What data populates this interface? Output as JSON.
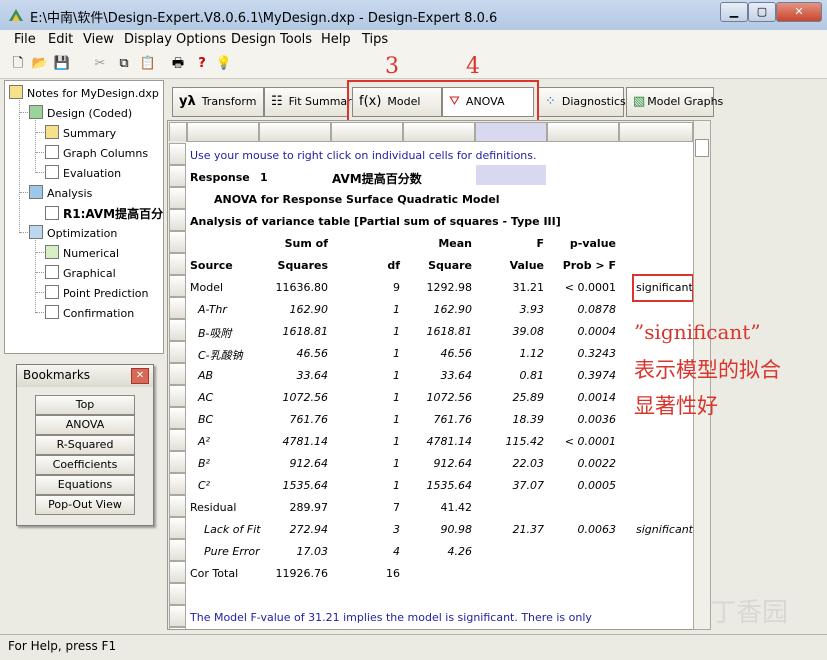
{
  "window": {
    "title": "E:\\中南\\软件\\Design-Expert.V8.0.6.1\\MyDesign.dxp - Design-Expert 8.0.6"
  },
  "menubar": [
    "File",
    "Edit",
    "View",
    "Display Options",
    "Design Tools",
    "Help",
    "Tips"
  ],
  "tree": {
    "root": "Notes for MyDesign.dxp",
    "design": "Design (Coded)",
    "summary": "Summary",
    "graph_columns": "Graph Columns",
    "evaluation": "Evaluation",
    "analysis": "Analysis",
    "response": "R1:AVM提高百分数",
    "optimization": "Optimization",
    "numerical": "Numerical",
    "graphical": "Graphical",
    "point_prediction": "Point Prediction",
    "confirmation": "Confirmation"
  },
  "bookmarks": {
    "title": "Bookmarks",
    "items": [
      "Top",
      "ANOVA",
      "R-Squared",
      "Coefficients",
      "Equations",
      "Pop-Out View"
    ]
  },
  "view_buttons": {
    "transform": "Transform",
    "fit_summary": "Fit Summary",
    "model": "Model",
    "anova": "ANOVA",
    "diagnostics": "Diagnostics",
    "model_graphs": "Model Graphs"
  },
  "report": {
    "hint": "Use your mouse to right click on individual cells for definitions.",
    "response_label": "Response",
    "response_num": "1",
    "response_name": "AVM提高百分数",
    "anova_title": "ANOVA for Response Surface Quadratic Model",
    "table_title": "Analysis of variance table [Partial sum of squares - Type III]",
    "headers1": {
      "ss": "Sum of",
      "ms": "Mean",
      "f": "F",
      "p": "p-value"
    },
    "headers2": {
      "source": "Source",
      "ss": "Squares",
      "df": "df",
      "ms": "Square",
      "f": "Value",
      "p": "Prob > F"
    },
    "rows": [
      {
        "source": "Model",
        "ss": "11636.80",
        "df": "9",
        "ms": "1292.98",
        "f": "31.21",
        "p": "< 0.0001",
        "note": "significant"
      },
      {
        "source": "A-Thr",
        "ss": "162.90",
        "df": "1",
        "ms": "162.90",
        "f": "3.93",
        "p": "0.0878",
        "note": ""
      },
      {
        "source": "B-吸附",
        "ss": "1618.81",
        "df": "1",
        "ms": "1618.81",
        "f": "39.08",
        "p": "0.0004",
        "note": ""
      },
      {
        "source": "C-乳酸钠",
        "ss": "46.56",
        "df": "1",
        "ms": "46.56",
        "f": "1.12",
        "p": "0.3243",
        "note": ""
      },
      {
        "source": "AB",
        "ss": "33.64",
        "df": "1",
        "ms": "33.64",
        "f": "0.81",
        "p": "0.3974",
        "note": ""
      },
      {
        "source": "AC",
        "ss": "1072.56",
        "df": "1",
        "ms": "1072.56",
        "f": "25.89",
        "p": "0.0014",
        "note": ""
      },
      {
        "source": "BC",
        "ss": "761.76",
        "df": "1",
        "ms": "761.76",
        "f": "18.39",
        "p": "0.0036",
        "note": ""
      },
      {
        "source": "A²",
        "ss": "4781.14",
        "df": "1",
        "ms": "4781.14",
        "f": "115.42",
        "p": "< 0.0001",
        "note": ""
      },
      {
        "source": "B²",
        "ss": "912.64",
        "df": "1",
        "ms": "912.64",
        "f": "22.03",
        "p": "0.0022",
        "note": ""
      },
      {
        "source": "C²",
        "ss": "1535.64",
        "df": "1",
        "ms": "1535.64",
        "f": "37.07",
        "p": "0.0005",
        "note": ""
      },
      {
        "source": "Residual",
        "ss": "289.97",
        "df": "7",
        "ms": "41.42",
        "f": "",
        "p": "",
        "note": ""
      },
      {
        "source": "Lack of Fit",
        "ss": "272.94",
        "df": "3",
        "ms": "90.98",
        "f": "21.37",
        "p": "0.0063",
        "note": "significant"
      },
      {
        "source": "Pure Error",
        "ss": "17.03",
        "df": "4",
        "ms": "4.26",
        "f": "",
        "p": "",
        "note": ""
      },
      {
        "source": "Cor Total",
        "ss": "11926.76",
        "df": "16",
        "ms": "",
        "f": "",
        "p": "",
        "note": ""
      }
    ],
    "footer": "The Model F-value of 31.21 implies the model is significant.  There is only"
  },
  "annotations": {
    "num3": "3",
    "num4": "4",
    "sig_word": "”significant”",
    "line2": "表示模型的拟合",
    "line3": "显著性好"
  },
  "statusbar": {
    "text": "For Help, press F1"
  },
  "watermark": "丁香园",
  "colors": {
    "annotation_red": "#d9352c",
    "report_blue": "#1f1fa0",
    "selected_cell": "#d8d8f0"
  }
}
